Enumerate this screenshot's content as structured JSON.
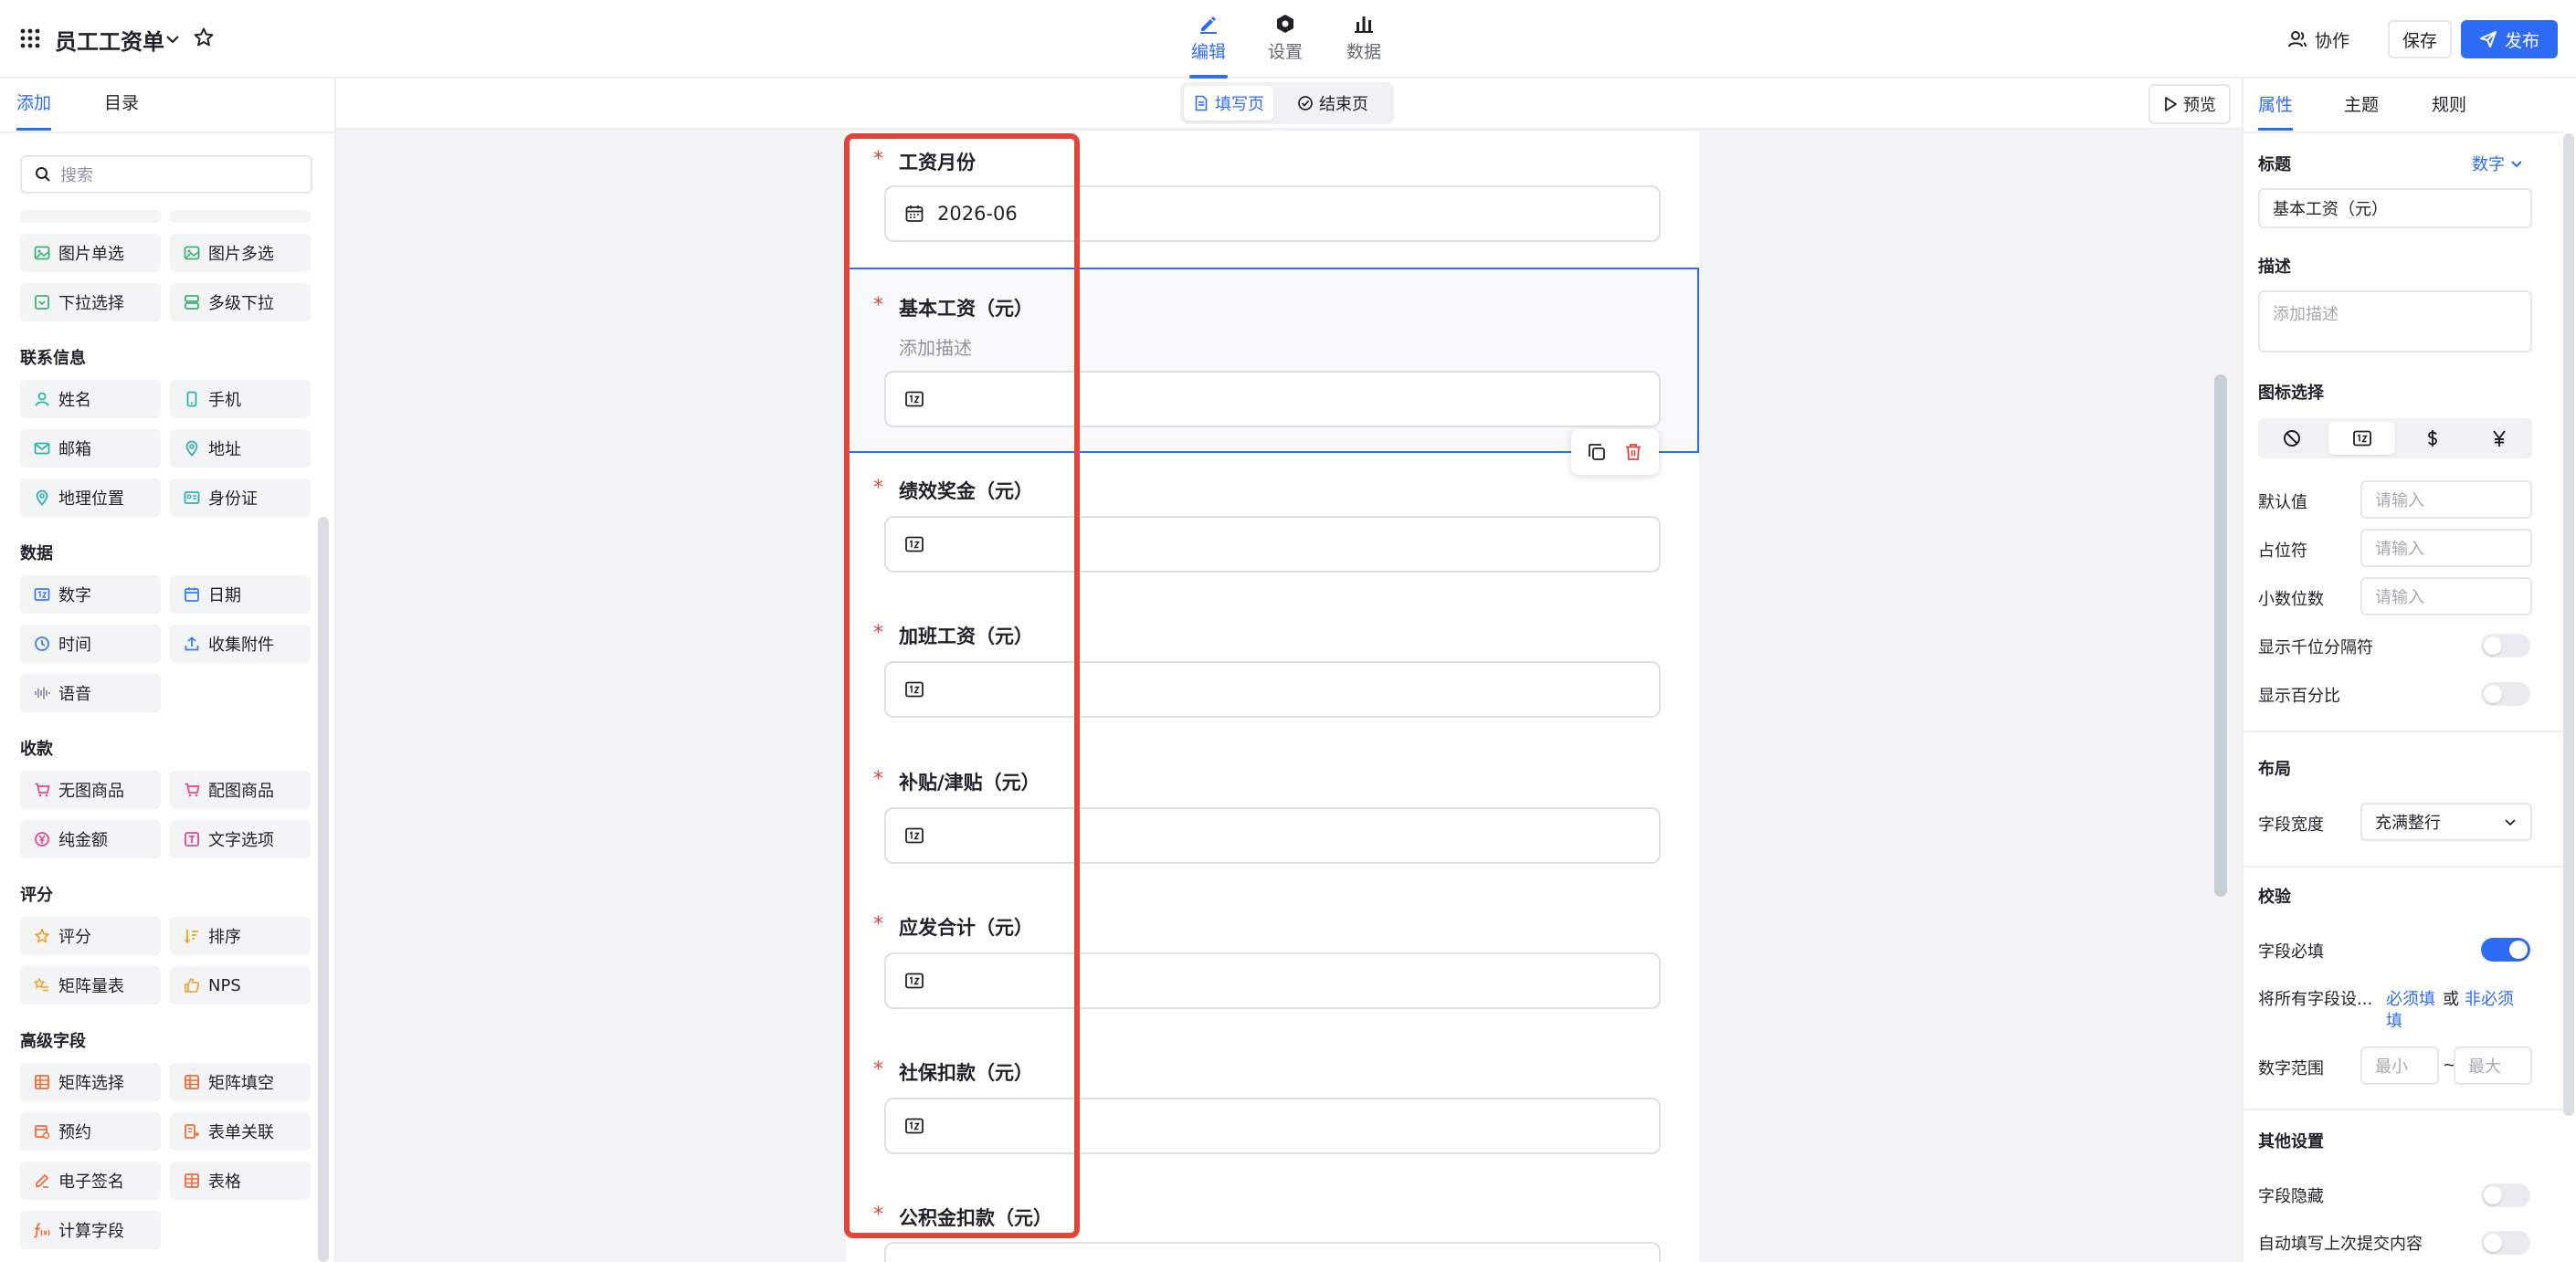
{
  "app": {
    "title": "员工工资单"
  },
  "nav_tabs": [
    {
      "label": "编辑",
      "active": true
    },
    {
      "label": "设置"
    },
    {
      "label": "数据"
    }
  ],
  "header_actions": {
    "collab": "协作",
    "save": "保存",
    "publish": "发布"
  },
  "left_panel": {
    "tabs": [
      "添加",
      "目录"
    ],
    "search_placeholder": "搜索",
    "top_items": [
      "图片单选",
      "图片多选",
      "下拉选择",
      "多级下拉"
    ],
    "sections": [
      {
        "title": "联系信息",
        "items": [
          "姓名",
          "手机",
          "邮箱",
          "地址",
          "地理位置",
          "身份证"
        ]
      },
      {
        "title": "数据",
        "items": [
          "数字",
          "日期",
          "时间",
          "收集附件",
          "语音"
        ]
      },
      {
        "title": "收款",
        "items": [
          "无图商品",
          "配图商品",
          "纯金额",
          "文字选项"
        ]
      },
      {
        "title": "评分",
        "items": [
          "评分",
          "排序",
          "矩阵量表",
          "NPS"
        ]
      },
      {
        "title": "高级字段",
        "items": [
          "矩阵选择",
          "矩阵填空",
          "预约",
          "表单关联",
          "电子签名",
          "表格",
          "计算字段"
        ]
      }
    ]
  },
  "page_tabs": {
    "fill": "填写页",
    "end": "结束页",
    "preview": "预览"
  },
  "form": {
    "fields": [
      {
        "label": "工资月份",
        "value": "2026-06",
        "required": true
      },
      {
        "label": "基本工资（元）",
        "description": "添加描述",
        "required": true,
        "selected": true
      },
      {
        "label": "绩效奖金（元）",
        "required": true
      },
      {
        "label": "加班工资（元）",
        "required": true
      },
      {
        "label": "补贴/津贴（元）",
        "required": true
      },
      {
        "label": "应发合计（元）",
        "required": true
      },
      {
        "label": "社保扣款（元）",
        "required": true
      },
      {
        "label": "公积金扣款（元）",
        "required": true
      }
    ],
    "required_mark": "*"
  },
  "right_panel": {
    "tabs": [
      "属性",
      "主题",
      "规则"
    ],
    "title_label": "标题",
    "type_label": "数字",
    "title_value": "基本工资（元）",
    "desc_label": "描述",
    "desc_placeholder": "添加描述",
    "icon_label": "图标选择",
    "default_label": "默认值",
    "placeholder_label": "占位符",
    "decimals_label": "小数位数",
    "input_placeholder": "请输入",
    "thousands_label": "显示千位分隔符",
    "thousands_on": false,
    "percent_label": "显示百分比",
    "percent_on": false,
    "layout_head": "布局",
    "width_label": "字段宽度",
    "width_value": "充满整行",
    "validate_head": "校验",
    "required_label": "字段必填",
    "required_on": true,
    "set_all_label": "将所有字段设...",
    "set_required": "必须填",
    "or_text": "或",
    "set_optional_1": "非必须",
    "set_optional_2": "填",
    "range_label": "数字范围",
    "min_placeholder": "最小",
    "max_placeholder": "最大",
    "range_sep": "~",
    "other_head": "其他设置",
    "hidden_label": "字段隐藏",
    "hidden_on": false,
    "autofill_label": "自动填写上次提交内容",
    "autofill_on": false
  },
  "colors": {
    "accent": "#2f6cf6",
    "required": "#e0453a",
    "highlight_box": "#e0453a"
  }
}
